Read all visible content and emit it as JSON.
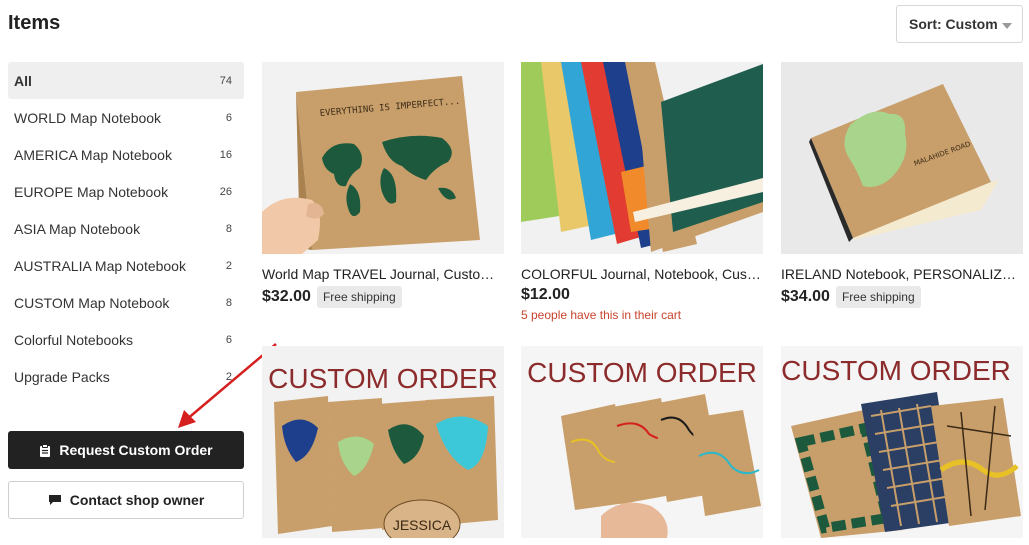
{
  "page": {
    "title": "Items"
  },
  "sort": {
    "label": "Sort: Custom"
  },
  "sidebar": {
    "categories": [
      {
        "label": "All",
        "count": "74"
      },
      {
        "label": "WORLD Map Notebook",
        "count": "6"
      },
      {
        "label": "AMERICA Map Notebook",
        "count": "16"
      },
      {
        "label": "EUROPE Map Notebook",
        "count": "26"
      },
      {
        "label": "ASIA Map Notebook",
        "count": "8"
      },
      {
        "label": "AUSTRALIA Map Notebook",
        "count": "2"
      },
      {
        "label": "CUSTOM Map Notebook",
        "count": "8"
      },
      {
        "label": "Colorful Notebooks",
        "count": "6"
      },
      {
        "label": "Upgrade Packs",
        "count": "2"
      }
    ],
    "request_button": "Request Custom Order",
    "contact_button": "Contact shop owner"
  },
  "products": [
    {
      "title": "World Map TRAVEL Journal, Custom Notebook",
      "price": "$32.00",
      "badge": "Free shipping",
      "cover_text": "EVERYTHING IS IMPERFECT..."
    },
    {
      "title": "COLORFUL Journal, Notebook, Custom Notebook",
      "price": "$12.00",
      "cart_note": "5 people have this in their cart"
    },
    {
      "title": "IRELAND Notebook, PERSONALIZED Notebook",
      "price": "$34.00",
      "badge": "Free shipping",
      "cover_text": "MALAHIDE ROAD"
    },
    {
      "banner": "CUSTOM ORDER",
      "name_tag": "JESSICA"
    },
    {
      "banner": "CUSTOM ORDER"
    },
    {
      "banner": "CUSTOM ORDER"
    }
  ],
  "colors": {
    "accent_red": "#d6201f",
    "dark_button": "#222222",
    "cart_note": "#c8442d",
    "kraft": "#c89f6b"
  }
}
